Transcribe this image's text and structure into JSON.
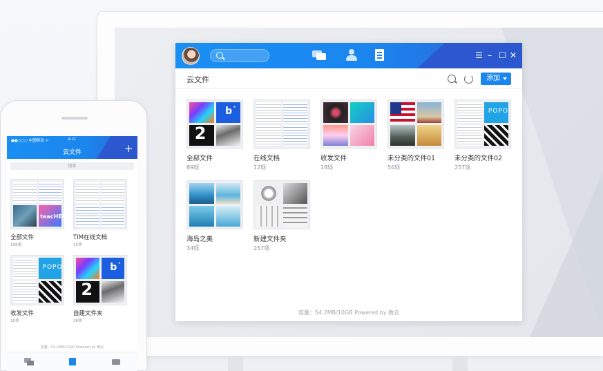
{
  "colors": {
    "accent": "#1a86ee",
    "header_start": "#1a8ff2",
    "header_end": "#2c58cf"
  },
  "desktop": {
    "window_controls": [
      "menu-icon",
      "minimize-icon",
      "maximize-icon",
      "close-icon"
    ],
    "nav_icons": [
      "chat-icon",
      "contacts-icon",
      "documents-icon"
    ],
    "page_title": "云文件",
    "add_button": "添加",
    "folders": [
      {
        "name": "全部文件",
        "count": "89项"
      },
      {
        "name": "在线文档",
        "count": "12项"
      },
      {
        "name": "收发文件",
        "count": "18项"
      },
      {
        "name": "未分类的文件01",
        "count": "56项"
      },
      {
        "name": "未分类的文件02",
        "count": "257项"
      },
      {
        "name": "海岛之美",
        "count": "34项"
      },
      {
        "name": "新建文件夹",
        "count": "257项"
      }
    ],
    "footer": "容量：54.2MB/10GB    Powered by 微云"
  },
  "phone": {
    "carrier": "●●○○○ 中国移动 ᯤ",
    "time": "4:21",
    "title": "云文件",
    "add_symbol": "+",
    "search_placeholder": "搜索",
    "folders": [
      {
        "name": "全部文件",
        "count": "158项"
      },
      {
        "name": "TIM在线文档",
        "count": "15项"
      },
      {
        "name": "收发文件",
        "count": "15项"
      },
      {
        "name": "自建文件夹",
        "count": "26项"
      }
    ],
    "footer": "容量：54.2MB/10GB    Powered by 微云",
    "tabs": [
      "chat-icon",
      "documents-icon",
      "toolbox-icon"
    ]
  }
}
